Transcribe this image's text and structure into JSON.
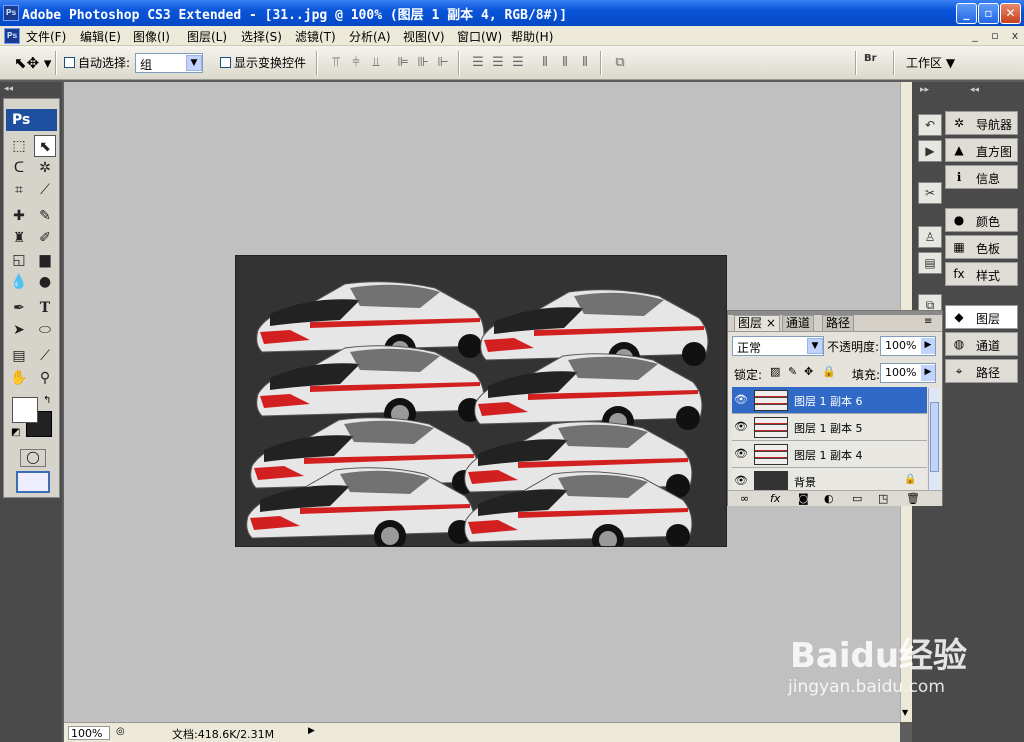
{
  "window": {
    "app_icon": "Ps",
    "title": "Adobe Photoshop CS3 Extended - [31..jpg @ 100% (图层 1 副本 4, RGB/8#)]",
    "minimize": "_",
    "restore": "▫",
    "close": "✕"
  },
  "menu": {
    "items": [
      "文件(F)",
      "编辑(E)",
      "图像(I)",
      "图层(L)",
      "选择(S)",
      "滤镜(T)",
      "分析(A)",
      "视图(V)",
      "窗口(W)",
      "帮助(H)"
    ],
    "mdi_min": "_",
    "mdi_restore": "▫",
    "mdi_close": "x"
  },
  "options": {
    "auto_select_label": "自动选择:",
    "auto_select_value": "组",
    "show_transform_label": "显示变换控件",
    "workspace_label": "工作区 ▼",
    "bridge_label": "Br"
  },
  "toolbox": {
    "logo": "Ps"
  },
  "document": {
    "zoom": "100%",
    "doc_info": "文档:418.6K/2.31M"
  },
  "dock_items": [
    {
      "label": "导航器",
      "icon": "navigator-icon",
      "glyph": "✲"
    },
    {
      "label": "直方图",
      "icon": "histogram-icon",
      "glyph": "▲"
    },
    {
      "label": "信息",
      "icon": "info-icon",
      "glyph": "ℹ"
    },
    {
      "label": "颜色",
      "icon": "color-icon",
      "glyph": "●"
    },
    {
      "label": "色板",
      "icon": "swatches-icon",
      "glyph": "▦"
    },
    {
      "label": "样式",
      "icon": "styles-icon",
      "glyph": "fx"
    },
    {
      "label": "图层",
      "icon": "layers-icon",
      "glyph": "◆"
    },
    {
      "label": "通道",
      "icon": "channels-icon",
      "glyph": "◍"
    },
    {
      "label": "路径",
      "icon": "paths-icon",
      "glyph": "⌖"
    }
  ],
  "layers_panel": {
    "tabs": [
      "图层 ×",
      "通道",
      "路径"
    ],
    "blend_mode": "正常",
    "opacity_label": "不透明度:",
    "opacity_value": "100%",
    "lock_label": "锁定:",
    "fill_label": "填充:",
    "fill_value": "100%",
    "layers": [
      {
        "name": "图层 1 副本 6",
        "selected": true
      },
      {
        "name": "图层 1 副本 5",
        "selected": false
      },
      {
        "name": "图层 1 副本 4",
        "selected": false
      },
      {
        "name": "背景",
        "selected": false,
        "locked": true
      }
    ],
    "footer_icons": [
      "link-icon",
      "fx-icon",
      "mask-icon",
      "adjustment-icon",
      "group-icon",
      "new-layer-icon",
      "trash-icon"
    ]
  },
  "watermark": {
    "text": "Baidu经验",
    "url": "jingyan.baidu.com"
  },
  "colors": {
    "title_blue": "#0a55d9",
    "selection_blue": "#3169c6",
    "canvas_gray": "#c0c0c0",
    "car_red": "#d22020"
  }
}
